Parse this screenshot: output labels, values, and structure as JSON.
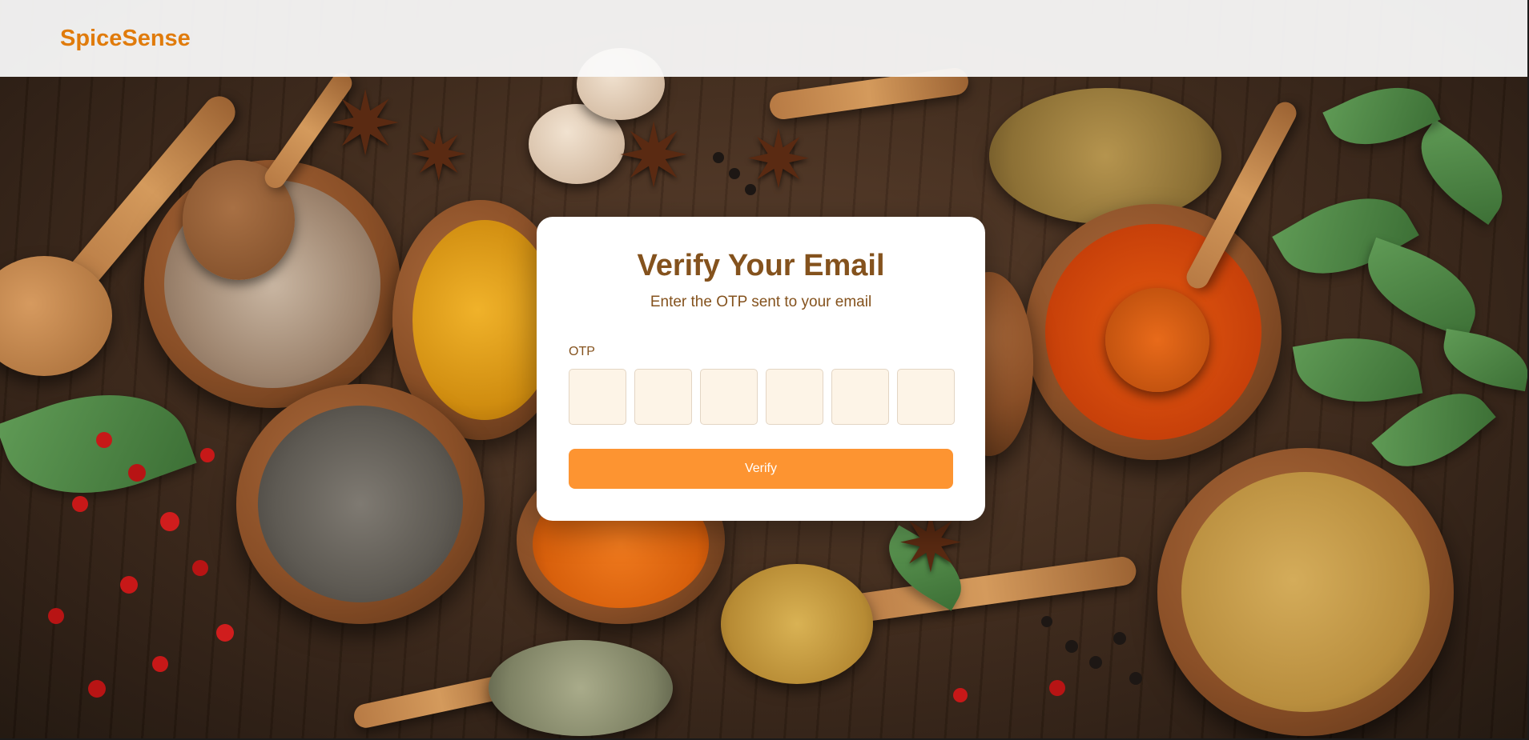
{
  "header": {
    "brand": "SpiceSense"
  },
  "card": {
    "title": "Verify Your Email",
    "subtitle": "Enter the OTP sent to your email",
    "otp_label": "OTP",
    "otp_digits": [
      "",
      "",
      "",
      "",
      "",
      ""
    ],
    "verify_label": "Verify"
  },
  "background": {
    "description_icon": "spices-photo"
  },
  "colors": {
    "brand": "#e07b0b",
    "text_brown": "#84521d",
    "button": "#fd9431",
    "otp_box_bg": "#fdf4e7",
    "header_bg": "#fafafa"
  }
}
